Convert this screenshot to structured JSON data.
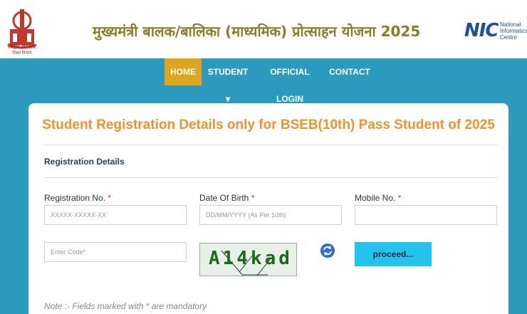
{
  "header": {
    "title": "मुख्यमंत्री बालक/बालिका (माध्यमिक) प्रोत्साहन योजना 2025",
    "emblem_line1": "बिहार सरकार",
    "emblem_line2": "शिक्षा विभाग",
    "nic_line1": "National",
    "nic_line2": "Informatics",
    "nic_line3": "Centre",
    "nic_mark": "NIC"
  },
  "nav": {
    "items": [
      "HOME",
      "STUDENT ▾",
      "OFFICIAL LOGIN",
      "CONTACT"
    ],
    "active": "HOME"
  },
  "form": {
    "title": "Student Registration Details only for BSEB(10th) Pass Student of 2025",
    "section": "Registration Details",
    "registration_label": "Registration No.",
    "registration_placeholder": "XXXXX-XXXXX-XX",
    "dob_label": "Date Of Birth",
    "dob_placeholder": "DD/MM/YYYY (As Per 10th)",
    "mobile_label": "Mobile No.",
    "mobile_placeholder": "",
    "code_placeholder": "Enter Code*",
    "captcha_text": "A14kad",
    "proceed_label": "proceed...",
    "required_mark": "*",
    "note": "Note :- Fields marked with * are mandatory"
  },
  "colors": {
    "nav_bg": "#2a9bbd",
    "active_tab": "#e0a51e",
    "title_orange": "#f0922d",
    "proceed_button": "#22c4ee"
  }
}
